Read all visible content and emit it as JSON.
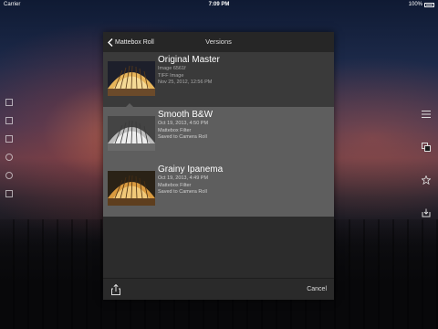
{
  "status_bar": {
    "carrier": "Carrier",
    "time": "7:09 PM",
    "battery": "100%"
  },
  "nav": {
    "back_label": "Mattebox Roll",
    "title": "Versions"
  },
  "versions": [
    {
      "name": "Original Master",
      "lines": [
        "Image 6561f",
        "TIFF Image",
        "Nov 25, 2012, 12:56 PM"
      ],
      "thumb": "color"
    },
    {
      "name": "Smooth B&W",
      "lines": [
        "Oct 19, 2013, 4:50 PM",
        "Mattebox Filter",
        "Saved to Camera Roll"
      ],
      "thumb": "bw"
    },
    {
      "name": "Grainy Ipanema",
      "lines": [
        "Oct 19, 2013, 4:49 PM",
        "Mattebox Filter",
        "Saved to Camera Roll"
      ],
      "thumb": "color"
    }
  ],
  "toolbar": {
    "cancel_label": "Cancel"
  },
  "icons": {
    "back": "chevron-left-icon",
    "share": "share-icon",
    "menu": "menu-icon",
    "copy": "copy-icon",
    "star": "star-icon",
    "save": "save-icon"
  }
}
